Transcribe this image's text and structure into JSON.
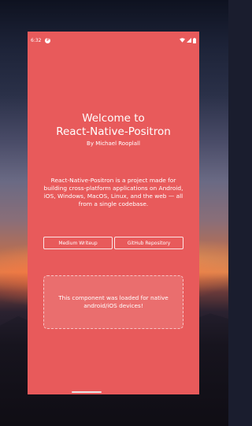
{
  "status_bar": {
    "time": "6:32",
    "notification_icon_letter": "P",
    "icons": [
      "wifi-icon",
      "signal-icon",
      "battery-icon"
    ]
  },
  "app": {
    "title_line1": "Welcome to",
    "title_line2": "React-Native-Positron",
    "byline": "By Michael Rooplall",
    "description": "React-Native-Positron is a project made for building cross-platform applications on Android, iOS, Windows, MacOS, Linux, and the web — all from a single codebase.",
    "buttons": [
      {
        "label": "Medium Writeup"
      },
      {
        "label": "GitHub Repository"
      }
    ],
    "native_card_text": "This component was loaded for native android/iOS devices!"
  },
  "colors": {
    "app_background": "#e85a5b",
    "text": "#ffffff"
  }
}
